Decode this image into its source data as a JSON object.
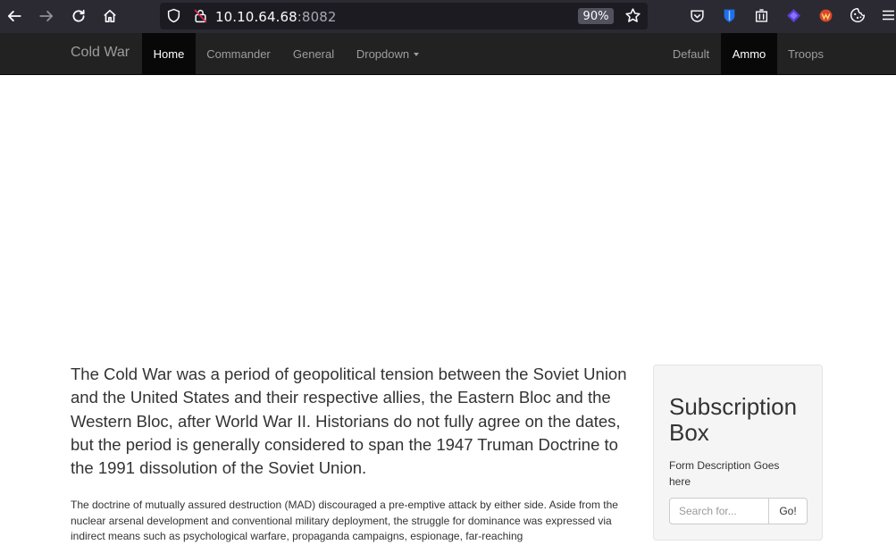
{
  "browser": {
    "url_host": "10.10.64.68",
    "url_port": ":8082",
    "zoom": "90%"
  },
  "navbar": {
    "brand": "Cold War",
    "left_items": [
      {
        "label": "Home",
        "active": true
      },
      {
        "label": "Commander",
        "active": false
      },
      {
        "label": "General",
        "active": false
      },
      {
        "label": "Dropdown",
        "active": false
      }
    ],
    "right_items": [
      {
        "label": "Default",
        "active": false
      },
      {
        "label": "Ammo",
        "active": true
      },
      {
        "label": "Troops",
        "active": false
      }
    ]
  },
  "main": {
    "lead": "The Cold War was a period of geopolitical tension between the Soviet Union and the United States and their respective allies, the Eastern Bloc and the Western Bloc, after World War II. Historians do not fully agree on the dates, but the period is generally considered to span the 1947 Truman Doctrine to the 1991 dissolution of the Soviet Union.",
    "body": "The doctrine of mutually assured destruction (MAD) discouraged a pre-emptive attack by either side. Aside from the nuclear arsenal development and conventional military deployment, the struggle for dominance was expressed via indirect means such as psychological warfare, propaganda campaigns, espionage, far-reaching"
  },
  "sidebar": {
    "title": "Subscription Box",
    "description": "Form Description Goes here",
    "search_placeholder": "Search for...",
    "go_label": "Go!"
  },
  "colors": {
    "chrome_bg": "#2b2a33",
    "navbar_bg": "#222222",
    "navbar_active_bg": "#080808",
    "well_bg": "#f5f5f5"
  }
}
